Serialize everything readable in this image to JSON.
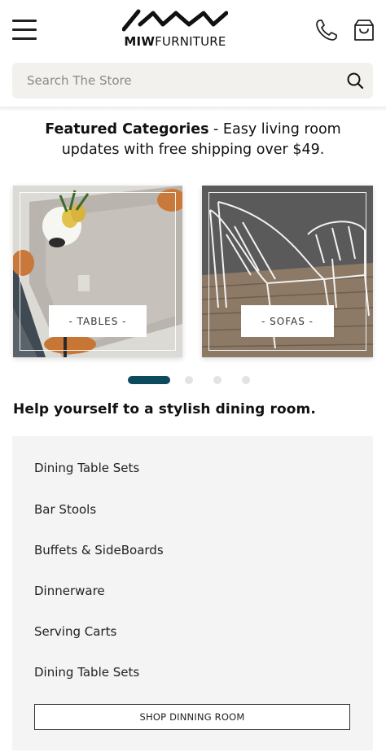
{
  "header": {
    "logo_bold": "MIW",
    "logo_rest": "FURNITURE",
    "icons": [
      "menu-icon",
      "phone-icon",
      "shopping-bag-icon"
    ]
  },
  "search": {
    "placeholder": "Search The Store",
    "icon": "search-icon"
  },
  "featured": {
    "title_bold": "Featured Categories",
    "rest": " - Easy living room updates with free shipping over $49."
  },
  "categories": [
    {
      "label": "- TABLES -"
    },
    {
      "label": "- SOFAS -"
    }
  ],
  "carousel": {
    "active_index": 0,
    "count": 4,
    "active_color": "#0e4a5e"
  },
  "dining": {
    "title": "Help yourself to a stylish dining room.",
    "links": [
      "Dining Table Sets",
      "Bar Stools",
      "Buffets & SideBoards",
      "Dinnerware",
      "Serving Carts",
      "Dining Table Sets"
    ],
    "button_label": "SHOP DINNING ROOM"
  }
}
